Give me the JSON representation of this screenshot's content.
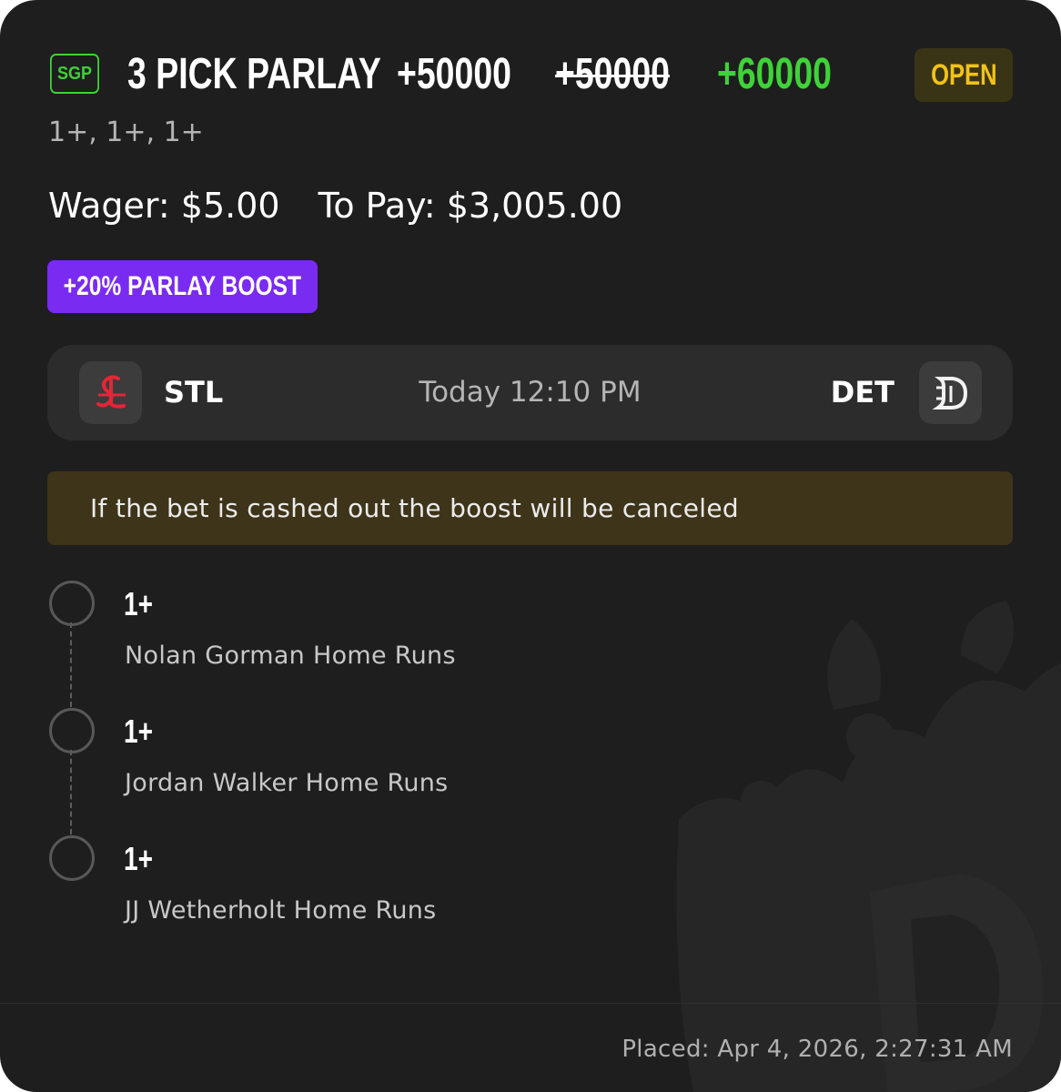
{
  "bet": {
    "tag": "SGP",
    "title": "3 PICK PARLAY",
    "original_odds": "+50000",
    "struck_odds": "+50000",
    "boosted_odds": "+60000",
    "status": "OPEN",
    "selections_summary": "1+, 1+, 1+",
    "wager": "Wager: $5.00",
    "to_pay": "To Pay: $3,005.00",
    "boost_label": "+20% PARLAY BOOST"
  },
  "game": {
    "away_team": "STL",
    "home_team": "DET",
    "time": "Today 12:10 PM",
    "away_logo_icon": "cardinals-stl-logo-icon",
    "home_logo_icon": "tigers-d-logo-icon"
  },
  "notice": "If the bet is cashed out the boost will be canceled",
  "legs": [
    {
      "value": "1+",
      "label": "Nolan Gorman Home Runs"
    },
    {
      "value": "1+",
      "label": "Jordan Walker Home Runs"
    },
    {
      "value": "1+",
      "label": "JJ Wetherholt Home Runs"
    }
  ],
  "footer": {
    "placed": "Placed: Apr 4, 2026, 2:27:31 AM"
  },
  "colors": {
    "background": "#1e1e1e",
    "green": "#3fd239",
    "gold": "#f2c318",
    "boost_purple": "#7a2bf2",
    "notice_bg": "#3e3419"
  }
}
